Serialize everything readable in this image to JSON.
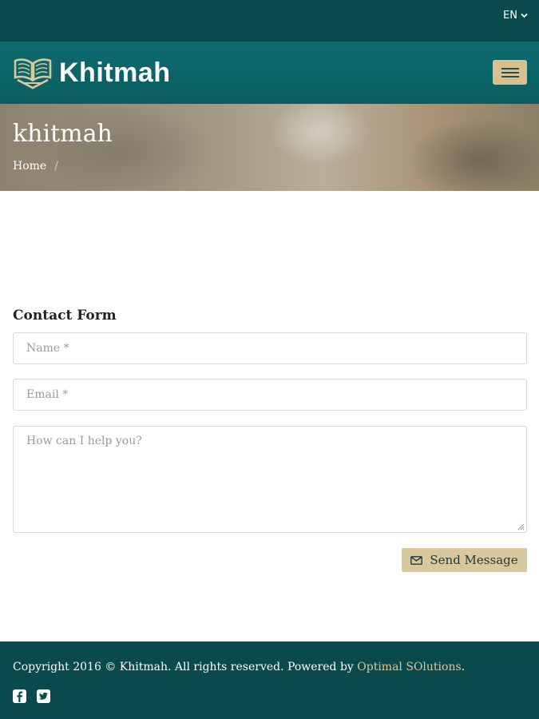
{
  "topbar": {
    "language": "EN",
    "language_icon": "chevron-down-icon"
  },
  "navbar": {
    "brand": "Khitmah",
    "logo_icon": "open-book-icon",
    "menu_icon": "hamburger-icon"
  },
  "hero": {
    "title": "khitmah",
    "breadcrumb": {
      "home": "Home",
      "separator": "/"
    }
  },
  "contact_form": {
    "title": "Contact Form",
    "name_placeholder": "Name *",
    "email_placeholder": "Email *",
    "message_placeholder": "How can I help you?",
    "send_label": "Send Message",
    "send_icon": "envelope-icon"
  },
  "footer": {
    "copyright_text": "Copyright 2016 © Khitmah. All rights reserved. Powered by ",
    "powered_by_link": "Optimal SOlutions",
    "period": ".",
    "social": [
      "facebook-icon",
      "twitter-icon"
    ]
  },
  "colors": {
    "topbar_bg": "#0a4a4d",
    "navbar_bg": "#0d6a6d",
    "accent_gold": "#d9c79d",
    "footer_bg": "#0a4a4d"
  }
}
